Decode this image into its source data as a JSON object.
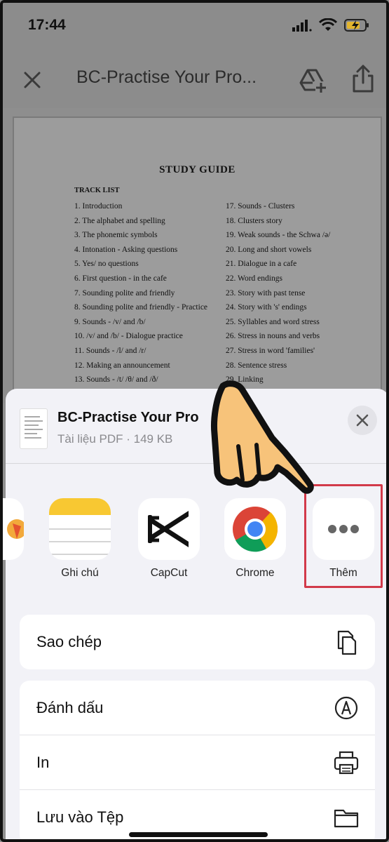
{
  "status_bar": {
    "time": "17:44"
  },
  "header": {
    "title": "BC-Practise Your Pro..."
  },
  "document": {
    "title": "STUDY GUIDE",
    "subtitle": "TRACK LIST",
    "left_column": [
      "1. Introduction",
      "2. The alphabet and spelling",
      "3. The phonemic symbols",
      "4. Intonation - Asking questions",
      "5. Yes/ no questions",
      "6. First question - in the cafe",
      "7. Sounding polite and friendly",
      "8. Sounding polite and friendly - Practice",
      "9. Sounds - /v/ and /b/",
      "10. /v/ and /b/ - Dialogue practice",
      "11. Sounds - /l/ and /r/",
      "12. Making an announcement",
      "13. Sounds - /t/ /θ/ and /ð/"
    ],
    "right_column": [
      "17. Sounds - Clusters",
      "18. Clusters story",
      "19. Weak sounds - the Schwa /ə/",
      "20. Long and short vowels",
      "21. Dialogue in a cafe",
      "22. Word endings",
      "23. Story with past tense",
      "24. Story with 's' endings",
      "25. Syllables and word stress",
      "26. Stress in nouns and verbs",
      "27. Stress in word 'families'",
      "28. Sentence stress",
      "29. Linking"
    ]
  },
  "share_sheet": {
    "file_name": "BC-Practise Your Pro",
    "file_meta": "Tài liệu PDF · 149 KB",
    "apps": [
      {
        "label": "Ghi chú",
        "icon": "notes-icon"
      },
      {
        "label": "CapCut",
        "icon": "capcut-icon"
      },
      {
        "label": "Chrome",
        "icon": "chrome-icon"
      },
      {
        "label": "Thêm",
        "icon": "more-icon"
      }
    ],
    "actions_group1": [
      {
        "label": "Sao chép",
        "icon": "copy-icon"
      }
    ],
    "actions_group2": [
      {
        "label": "Đánh dấu",
        "icon": "markup-icon"
      },
      {
        "label": "In",
        "icon": "print-icon"
      },
      {
        "label": "Lưu vào Tệp",
        "icon": "folder-icon"
      }
    ]
  },
  "colors": {
    "highlight": "#d23a4a",
    "sheet_bg": "#f2f2f7",
    "notes_yellow": "#f8c832"
  }
}
